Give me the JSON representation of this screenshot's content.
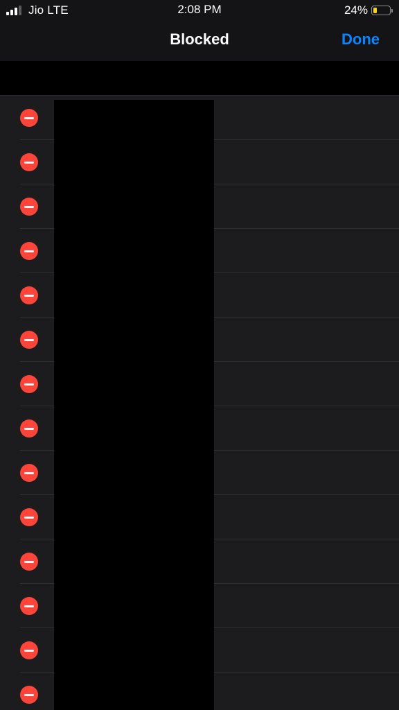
{
  "status_bar": {
    "carrier": "Jio LTE",
    "time": "2:08 PM",
    "battery_percent": "24%",
    "battery_level": 0.24,
    "signal_bars_active": 3,
    "signal_bars_total": 4,
    "battery_color": "#ffd60a"
  },
  "nav": {
    "title": "Blocked",
    "done_label": "Done",
    "accent_color": "#0a84ff"
  },
  "list": {
    "delete_color": "#ff453a",
    "rows": [
      {
        "id": 1
      },
      {
        "id": 2
      },
      {
        "id": 3
      },
      {
        "id": 4
      },
      {
        "id": 5
      },
      {
        "id": 6
      },
      {
        "id": 7
      },
      {
        "id": 8
      },
      {
        "id": 9
      },
      {
        "id": 10
      },
      {
        "id": 11
      },
      {
        "id": 12
      },
      {
        "id": 13
      },
      {
        "id": 14
      }
    ]
  }
}
